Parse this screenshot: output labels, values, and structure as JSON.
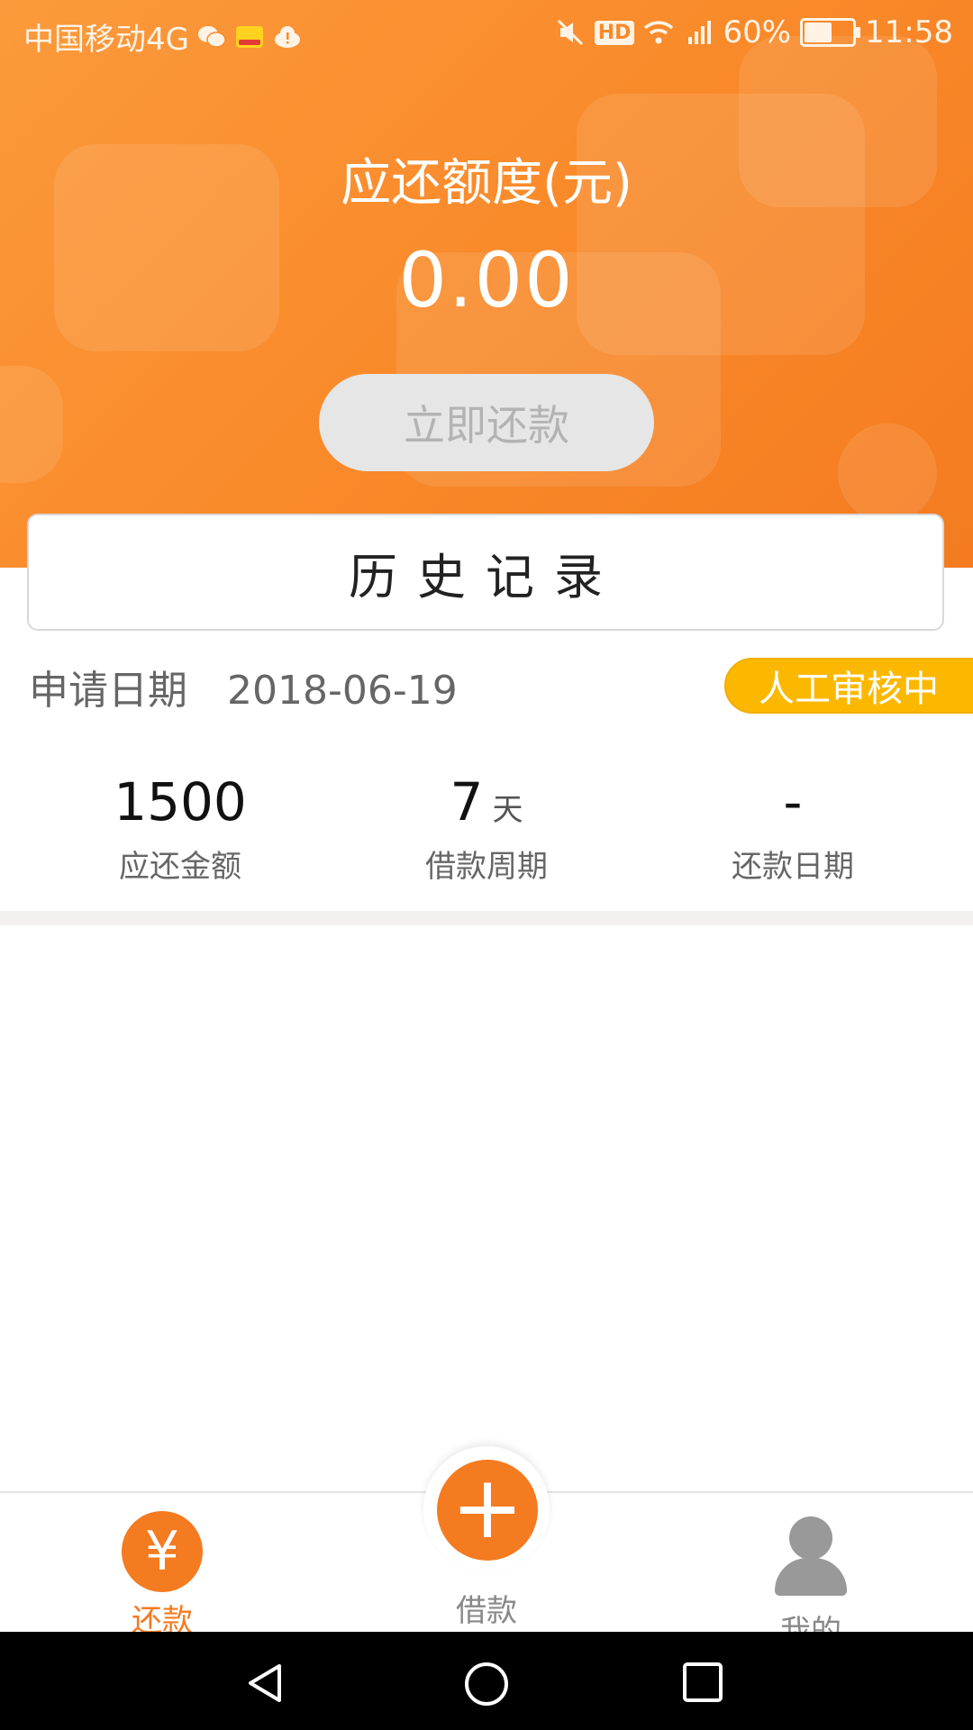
{
  "status_bar": {
    "carrier": "中国移动4G",
    "network_tag": "4G",
    "battery": "60%",
    "battery_level": 0.6,
    "time": "11:58"
  },
  "header": {
    "amount_title": "应还额度(元)",
    "amount_value": "0.00",
    "repay_button": "立即还款"
  },
  "history": {
    "label": "历史记录"
  },
  "record": {
    "apply_label": "申请日期",
    "apply_date": "2018-06-19",
    "status": "人工审核中",
    "stats": [
      {
        "value": "1500",
        "unit": "",
        "label": "应还金额"
      },
      {
        "value": "7",
        "unit": "天",
        "label": "借款周期"
      },
      {
        "value": "-",
        "unit": "",
        "label": "还款日期"
      }
    ]
  },
  "bottom_nav": {
    "repay": "还款",
    "borrow": "借款",
    "mine": "我的",
    "yen_symbol": "¥",
    "plus_symbol": "+"
  },
  "colors": {
    "accent": "#f47b20",
    "badge": "#fcb800",
    "button_disabled": "#e6e6e6"
  }
}
